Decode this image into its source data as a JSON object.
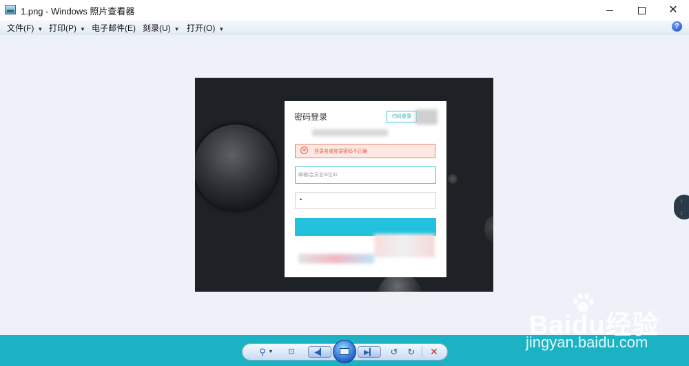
{
  "window": {
    "title": "1.png - Windows 照片查看器",
    "min_glyph": "",
    "max_glyph": "",
    "close_glyph": "✕"
  },
  "menu": [
    {
      "label": "文件(F)",
      "caret": "▼"
    },
    {
      "label": "打印(P)",
      "caret": "▼"
    },
    {
      "label": "电子邮件(E)",
      "caret": ""
    },
    {
      "label": "刻录(U)",
      "caret": "▼"
    },
    {
      "label": "打开(O)",
      "caret": "▼"
    }
  ],
  "help_label": "?",
  "login": {
    "title": "密码登录",
    "qr_button": "扫码登录",
    "error_icon": "⊗",
    "error_message": "登录名或登录密码不正确",
    "account_placeholder": "邮箱/会员名/8位ID",
    "password_value": "•"
  },
  "side_pill": {
    "up": "↑",
    "down": "↓"
  },
  "controls": {
    "zoom": "⚲",
    "zoom_caret": "▼",
    "fit": "⊡",
    "prev": "◀▎",
    "next": "▶▎",
    "rotate_left": "↺",
    "rotate_right": "↻",
    "delete": "✕"
  },
  "watermark": {
    "logo": "Baidu经验",
    "url": "jingyan.baidu.com"
  },
  "colors": {
    "bottom_bar": "#1bb3c3",
    "accent_cyan": "#22c2de",
    "error_red": "#e25a45"
  }
}
